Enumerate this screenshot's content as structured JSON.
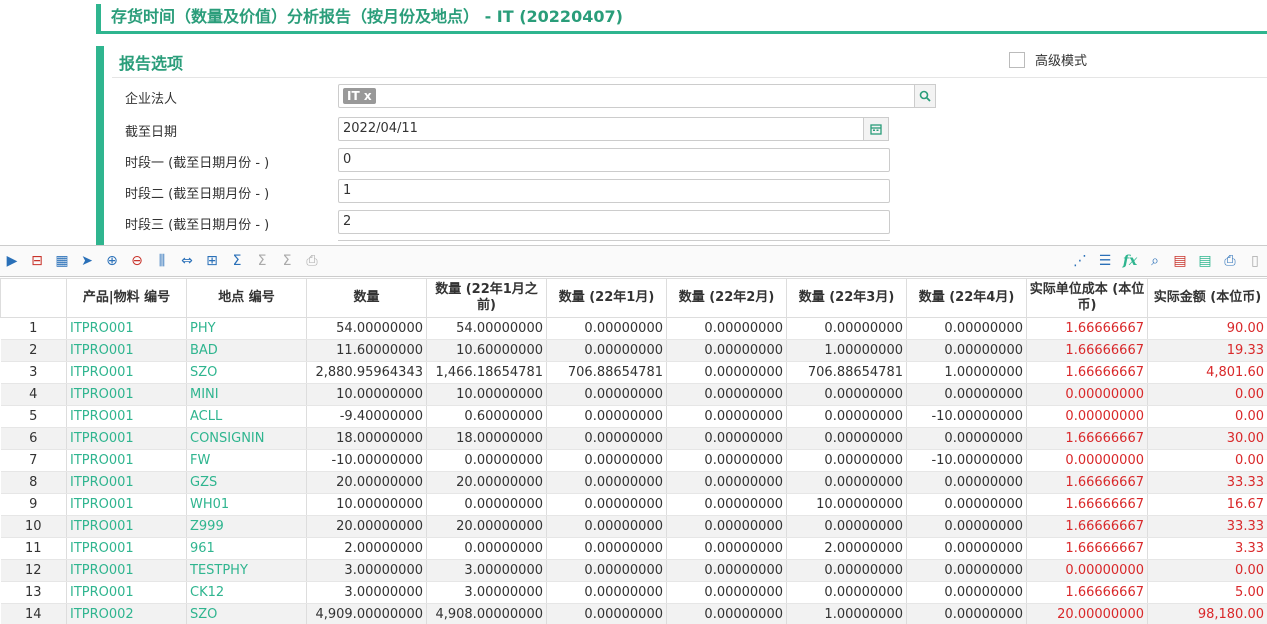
{
  "title": "存货时间（数量及价值）分析报告（按月份及地点） - IT (20220407)",
  "options": {
    "header": "报告选项",
    "advanced_label": "高级模式",
    "legal_entity_label": "企业法人",
    "legal_entity_tag": "IT x",
    "as_of_label": "截至日期",
    "as_of_value": "2022/04/11",
    "period1_label": "时段一 (截至日期月份 - )",
    "period1_value": "0",
    "period2_label": "时段二 (截至日期月份 - )",
    "period2_value": "1",
    "period3_label": "时段三 (截至日期月份 - )",
    "period3_value": "2"
  },
  "table": {
    "headers": [
      "",
      "产品|物料 编号",
      "地点 编号",
      "数量",
      "数量 (22年1月之前)",
      "数量 (22年1月)",
      "数量 (22年2月)",
      "数量 (22年3月)",
      "数量 (22年4月)",
      "实际单位成本 (本位币)",
      "实际金额 (本位币)"
    ],
    "rows": [
      [
        "1",
        "ITPRO001",
        "PHY",
        "54.00000000",
        "54.00000000",
        "0.00000000",
        "0.00000000",
        "0.00000000",
        "0.00000000",
        "1.66666667",
        "90.00"
      ],
      [
        "2",
        "ITPRO001",
        "BAD",
        "11.60000000",
        "10.60000000",
        "0.00000000",
        "0.00000000",
        "1.00000000",
        "0.00000000",
        "1.66666667",
        "19.33"
      ],
      [
        "3",
        "ITPRO001",
        "SZO",
        "2,880.95964343",
        "1,466.18654781",
        "706.88654781",
        "0.00000000",
        "706.88654781",
        "1.00000000",
        "1.66666667",
        "4,801.60"
      ],
      [
        "4",
        "ITPRO001",
        "MINI",
        "10.00000000",
        "10.00000000",
        "0.00000000",
        "0.00000000",
        "0.00000000",
        "0.00000000",
        "0.00000000",
        "0.00"
      ],
      [
        "5",
        "ITPRO001",
        "ACLL",
        "-9.40000000",
        "0.60000000",
        "0.00000000",
        "0.00000000",
        "0.00000000",
        "-10.00000000",
        "0.00000000",
        "0.00"
      ],
      [
        "6",
        "ITPRO001",
        "CONSIGNIN",
        "18.00000000",
        "18.00000000",
        "0.00000000",
        "0.00000000",
        "0.00000000",
        "0.00000000",
        "1.66666667",
        "30.00"
      ],
      [
        "7",
        "ITPRO001",
        "FW",
        "-10.00000000",
        "0.00000000",
        "0.00000000",
        "0.00000000",
        "0.00000000",
        "-10.00000000",
        "0.00000000",
        "0.00"
      ],
      [
        "8",
        "ITPRO001",
        "GZS",
        "20.00000000",
        "20.00000000",
        "0.00000000",
        "0.00000000",
        "0.00000000",
        "0.00000000",
        "1.66666667",
        "33.33"
      ],
      [
        "9",
        "ITPRO001",
        "WH01",
        "10.00000000",
        "0.00000000",
        "0.00000000",
        "0.00000000",
        "10.00000000",
        "0.00000000",
        "1.66666667",
        "16.67"
      ],
      [
        "10",
        "ITPRO001",
        "Z999",
        "20.00000000",
        "20.00000000",
        "0.00000000",
        "0.00000000",
        "0.00000000",
        "0.00000000",
        "1.66666667",
        "33.33"
      ],
      [
        "11",
        "ITPRO001",
        "961",
        "2.00000000",
        "0.00000000",
        "0.00000000",
        "0.00000000",
        "2.00000000",
        "0.00000000",
        "1.66666667",
        "3.33"
      ],
      [
        "12",
        "ITPRO001",
        "TESTPHY",
        "3.00000000",
        "3.00000000",
        "0.00000000",
        "0.00000000",
        "0.00000000",
        "0.00000000",
        "0.00000000",
        "0.00"
      ],
      [
        "13",
        "ITPRO001",
        "CK12",
        "3.00000000",
        "3.00000000",
        "0.00000000",
        "0.00000000",
        "0.00000000",
        "0.00000000",
        "1.66666667",
        "5.00"
      ],
      [
        "14",
        "ITPRO002",
        "SZO",
        "4,909.00000000",
        "4,908.00000000",
        "0.00000000",
        "0.00000000",
        "1.00000000",
        "0.00000000",
        "20.00000000",
        "98,180.00"
      ]
    ]
  }
}
